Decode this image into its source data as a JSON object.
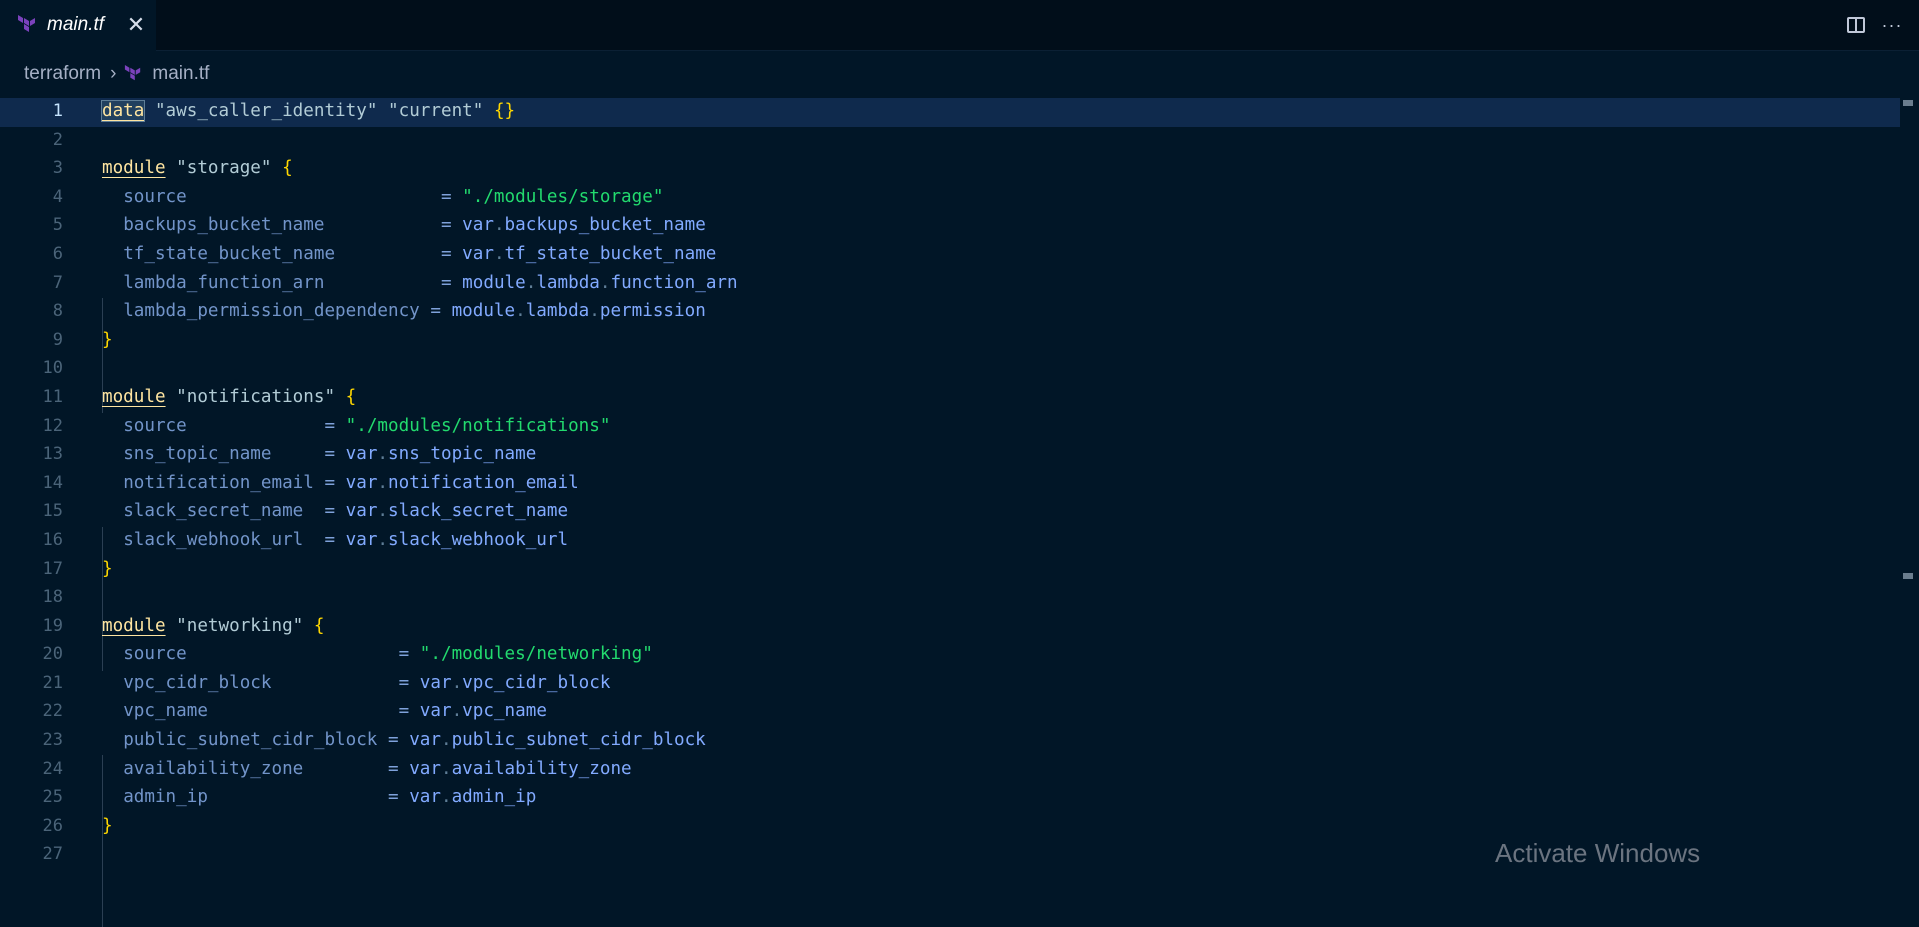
{
  "tab": {
    "label": "main.tf",
    "close": "✕"
  },
  "actions": {
    "more": "···"
  },
  "breadcrumb": {
    "folder": "terraform",
    "separator": "›",
    "file": "main.tf"
  },
  "editor": {
    "active_line": 1,
    "line_numbers": [
      "1",
      "2",
      "3",
      "4",
      "5",
      "6",
      "7",
      "8",
      "9",
      "10",
      "11",
      "12",
      "13",
      "14",
      "15",
      "16",
      "17",
      "18",
      "19",
      "20",
      "21",
      "22",
      "23",
      "24",
      "25",
      "26",
      "27"
    ]
  },
  "watermark": "Activate Windows",
  "colors": {
    "background": "#011627",
    "accent_purple": "#7b42bc"
  }
}
